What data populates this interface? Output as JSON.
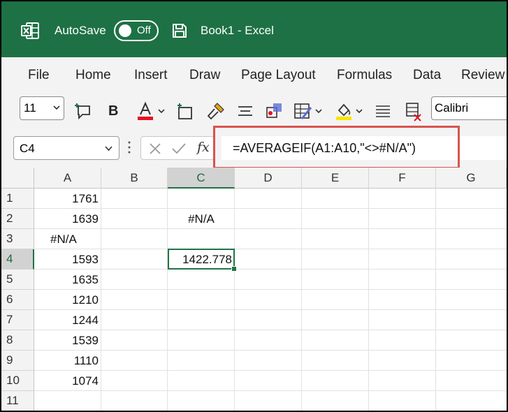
{
  "titlebar": {
    "autosave_label": "AutoSave",
    "toggle_state": "Off",
    "document_title": "Book1  -  Excel",
    "colors": {
      "background": "#1e7145",
      "text": "#ffffff"
    }
  },
  "menu": {
    "items": [
      "File",
      "Home",
      "Insert",
      "Draw",
      "Page Layout",
      "Formulas",
      "Data",
      "Review"
    ]
  },
  "ribbon": {
    "font_size": "11",
    "font_name": "Calibri",
    "bold_label": "B",
    "icons": [
      "comment-add-icon",
      "bold-icon",
      "font-color-icon",
      "insert-cells-icon",
      "format-painter-icon",
      "align-center-icon",
      "3d-shapes-icon",
      "conditional-format-icon",
      "fill-color-icon",
      "justify-icon",
      "clear-format-icon"
    ]
  },
  "formula_bar": {
    "name_box": "C4",
    "fx_label": "fx",
    "formula": "=AVERAGEIF(A1:A10,\"<>#N/A\")",
    "highlight_color": "#d9534f"
  },
  "sheet": {
    "columns": [
      "A",
      "B",
      "C",
      "D",
      "E",
      "F",
      "G"
    ],
    "rows": [
      "1",
      "2",
      "3",
      "4",
      "5",
      "6",
      "7",
      "8",
      "9",
      "10",
      "11"
    ],
    "selected_column": "C",
    "selected_row": "4",
    "cells": {
      "A1": "1761",
      "A2": "1639",
      "A3": "#N/A",
      "A4": "1593",
      "A5": "1635",
      "A6": "1210",
      "A7": "1244",
      "A8": "1539",
      "A9": "1110",
      "A10": "1074",
      "C2": "#N/A",
      "C4": "1422.778"
    },
    "accent_color": "#217346"
  }
}
